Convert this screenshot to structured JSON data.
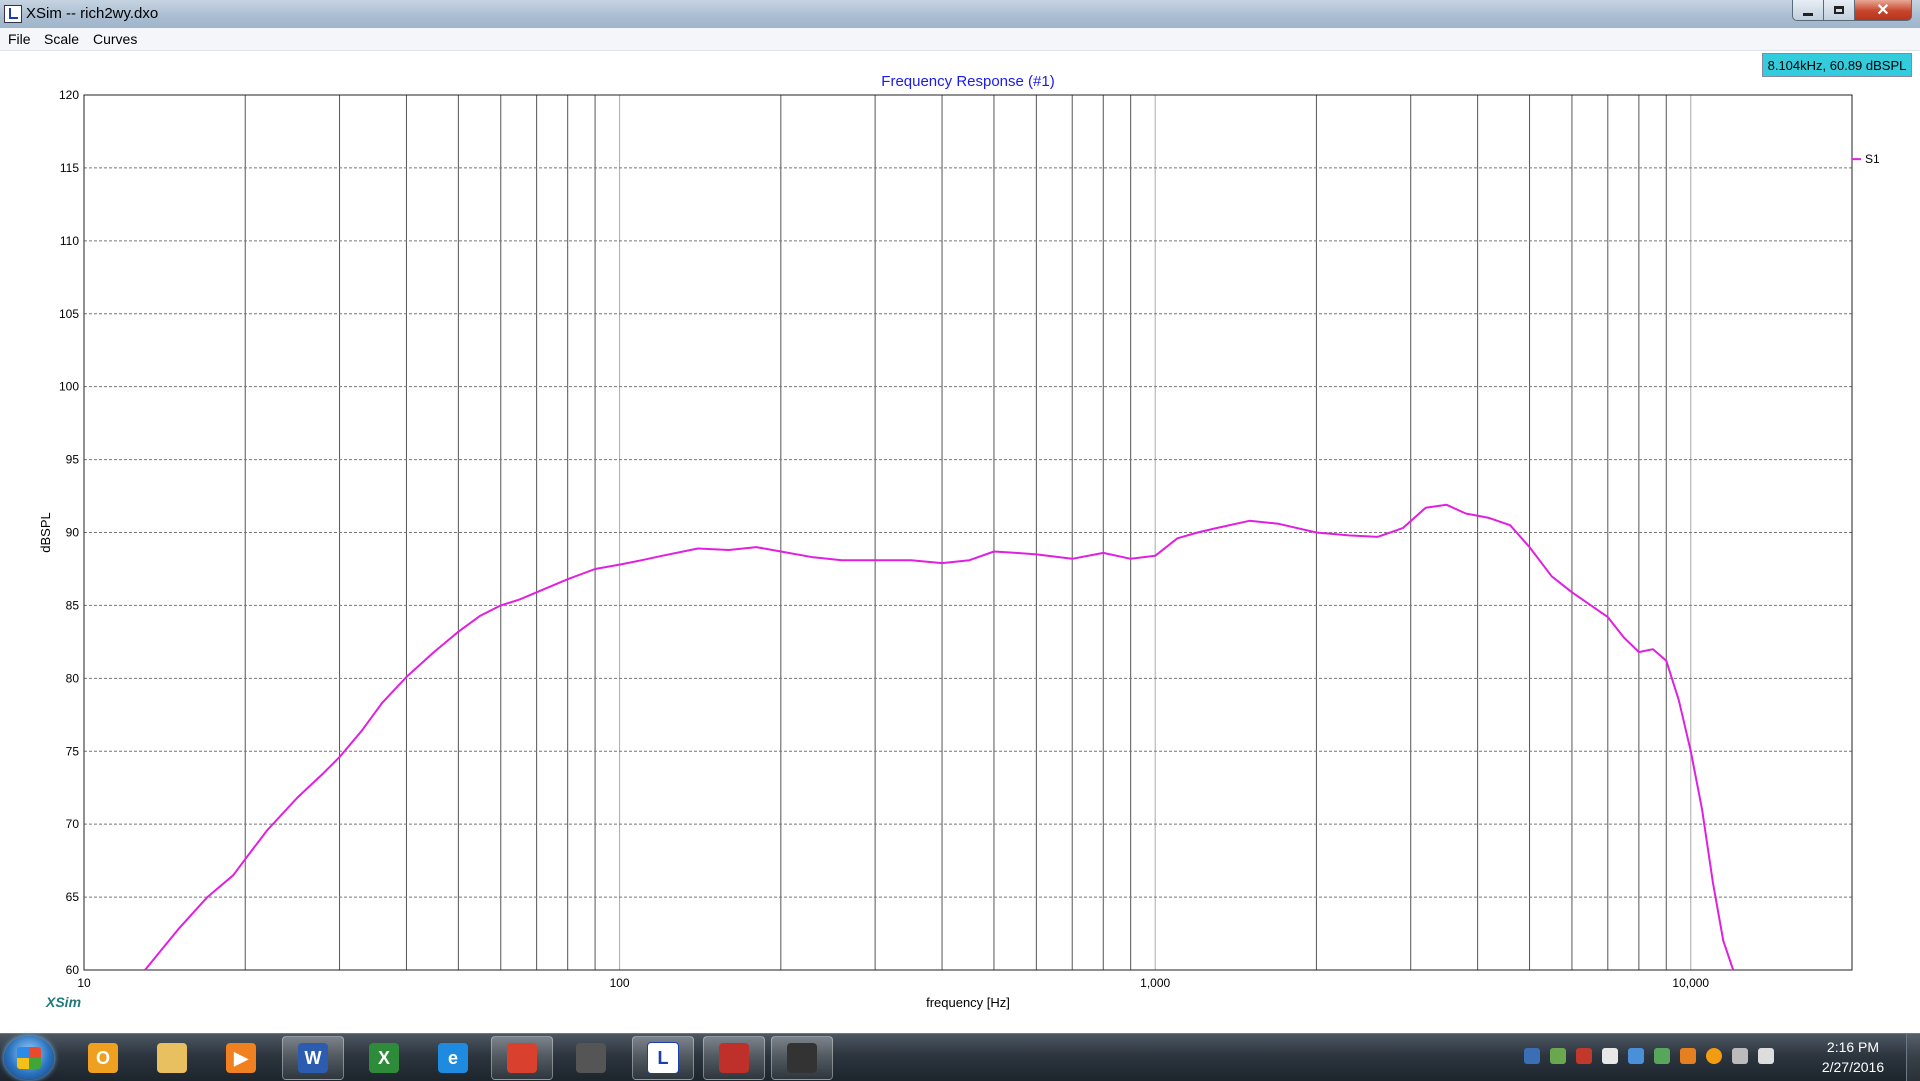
{
  "window": {
    "title": "XSim -- rich2wy.dxo",
    "close_glyph": "✕"
  },
  "menu": [
    "File",
    "Scale",
    "Curves"
  ],
  "readout": "8.104kHz, 60.89 dBSPL",
  "branding": "XSim",
  "chart_data": {
    "type": "line",
    "title": "Frequency Response (#1)",
    "xlabel": "frequency [Hz]",
    "ylabel": "dBSPL",
    "xscale": "log",
    "xlim": [
      10,
      20000
    ],
    "ylim": [
      60,
      120
    ],
    "grid": true,
    "legend_position": "right",
    "x_tick_labels": [
      {
        "value": 10,
        "label": "10"
      },
      {
        "value": 100,
        "label": "100"
      },
      {
        "value": 1000,
        "label": "1,000"
      },
      {
        "value": 10000,
        "label": "10,000"
      }
    ],
    "y_ticks": [
      60,
      65,
      70,
      75,
      80,
      85,
      90,
      95,
      100,
      105,
      110,
      115,
      120
    ],
    "series": [
      {
        "name": "S1",
        "color": "#e020e0",
        "x": [
          13,
          15,
          17,
          19,
          20,
          22,
          25,
          28,
          30,
          33,
          36,
          40,
          45,
          50,
          55,
          60,
          65,
          70,
          80,
          90,
          100,
          110,
          120,
          140,
          160,
          180,
          200,
          230,
          260,
          300,
          350,
          400,
          450,
          500,
          550,
          600,
          700,
          800,
          900,
          1000,
          1100,
          1200,
          1300,
          1500,
          1700,
          2000,
          2300,
          2600,
          2900,
          3200,
          3500,
          3800,
          4200,
          4600,
          5000,
          5500,
          6000,
          7000,
          7500,
          8000,
          8500,
          9000,
          9500,
          10000,
          10500,
          11000,
          11500,
          12000
        ],
        "y": [
          60.0,
          62.8,
          65.0,
          66.5,
          67.6,
          69.6,
          71.8,
          73.5,
          74.6,
          76.4,
          78.3,
          80.1,
          81.8,
          83.2,
          84.3,
          85.0,
          85.4,
          85.9,
          86.8,
          87.5,
          87.8,
          88.1,
          88.4,
          88.9,
          88.8,
          89.0,
          88.7,
          88.3,
          88.1,
          88.1,
          88.1,
          87.9,
          88.1,
          88.7,
          88.6,
          88.5,
          88.2,
          88.6,
          88.2,
          88.4,
          89.6,
          90.0,
          90.3,
          90.8,
          90.6,
          90.0,
          89.8,
          89.7,
          90.3,
          91.7,
          91.9,
          91.3,
          91.0,
          90.5,
          89.0,
          87.0,
          85.9,
          84.2,
          82.8,
          81.8,
          82.0,
          81.2,
          78.5,
          75.0,
          71.0,
          66.0,
          62.0,
          60.0
        ]
      }
    ]
  },
  "taskbar": {
    "apps": [
      {
        "name": "outlook",
        "glyph": "O",
        "color": "#f0a020"
      },
      {
        "name": "explorer",
        "glyph": "",
        "color": "#e8c060"
      },
      {
        "name": "media-player",
        "glyph": "▶",
        "color": "#f08020"
      },
      {
        "name": "word",
        "glyph": "W",
        "color": "#2b5cb0"
      },
      {
        "name": "excel",
        "glyph": "X",
        "color": "#2e8b3a"
      },
      {
        "name": "internet-explorer",
        "glyph": "e",
        "color": "#1f8be0"
      },
      {
        "name": "chrome",
        "glyph": "",
        "color": "#d9412e"
      },
      {
        "name": "speaker-app",
        "glyph": "",
        "color": "#555555"
      },
      {
        "name": "xsim",
        "glyph": "L",
        "color": "#ffffff"
      },
      {
        "name": "red-app",
        "glyph": "",
        "color": "#c0302a"
      },
      {
        "name": "multicolor-app",
        "glyph": "",
        "color": "#333333"
      }
    ],
    "clock": {
      "time": "2:16 PM",
      "date": "2/27/2016"
    }
  }
}
